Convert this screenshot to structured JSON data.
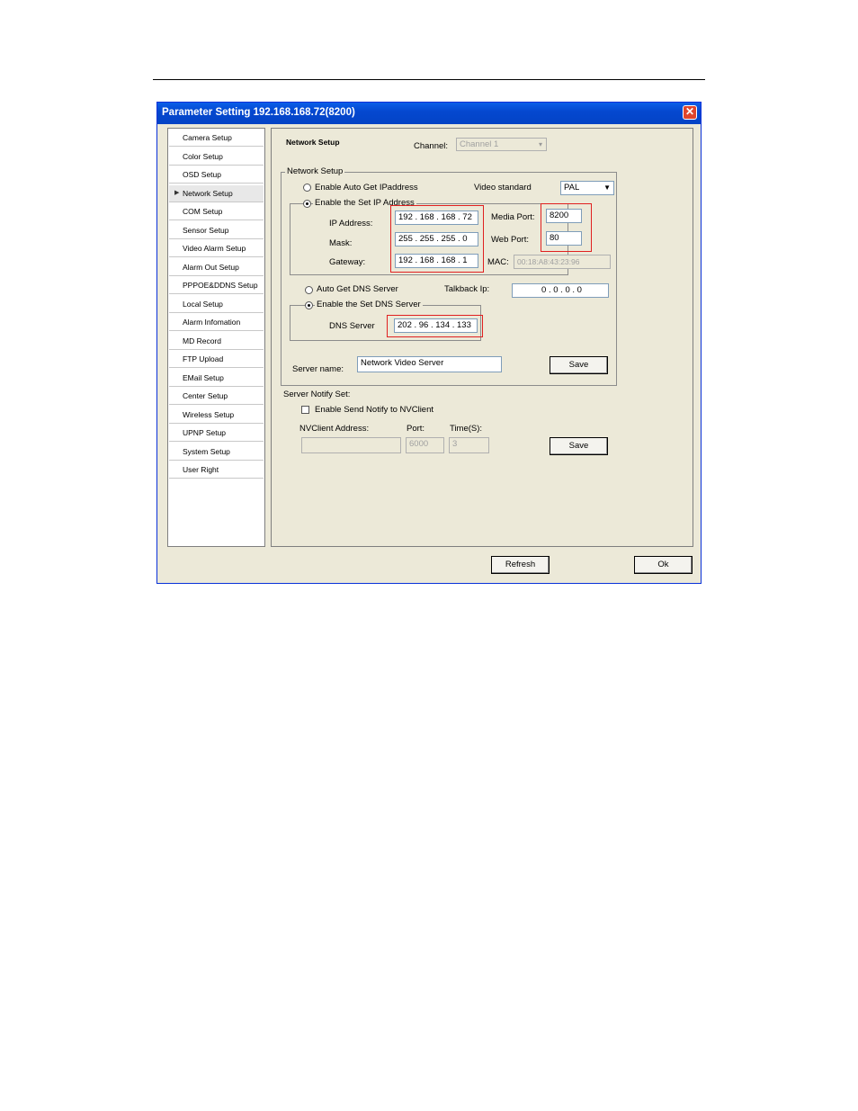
{
  "window": {
    "title": "Parameter Setting 192.168.168.72(8200)",
    "close": "✕"
  },
  "sidebar": {
    "items": [
      {
        "label": "Camera Setup"
      },
      {
        "label": "Color Setup"
      },
      {
        "label": "OSD Setup"
      },
      {
        "label": "Network Setup",
        "active": true
      },
      {
        "label": "COM Setup"
      },
      {
        "label": "Sensor Setup"
      },
      {
        "label": "Video Alarm Setup"
      },
      {
        "label": "Alarm Out Setup"
      },
      {
        "label": "PPPOE&DDNS Setup"
      },
      {
        "label": "Local Setup"
      },
      {
        "label": "Alarm Infomation"
      },
      {
        "label": "MD Record"
      },
      {
        "label": "FTP Upload"
      },
      {
        "label": "EMail Setup"
      },
      {
        "label": "Center Setup"
      },
      {
        "label": "Wireless Setup"
      },
      {
        "label": "UPNP Setup"
      },
      {
        "label": "System Setup"
      },
      {
        "label": "User Right"
      }
    ]
  },
  "panel": {
    "header": "Network Setup",
    "channel_label": "Channel:",
    "channel_value": "Channel 1",
    "network_group": "Network Setup",
    "auto_ip_label": "Enable Auto Get IPaddress",
    "set_ip_label": "Enable the Set IP Address",
    "ip_label": "IP Address:",
    "ip_value": "192 . 168 . 168 . 72",
    "mask_label": "Mask:",
    "mask_value": "255 . 255 . 255 .  0",
    "gateway_label": "Gateway:",
    "gateway_value": "192 . 168 . 168 .  1",
    "video_standard_label": "Video standard",
    "video_standard_value": "PAL",
    "media_port_label": "Media Port:",
    "media_port_value": "8200",
    "web_port_label": "Web Port:",
    "web_port_value": "80",
    "mac_label": "MAC:",
    "mac_value": "00:18:A8:43:23:96",
    "auto_dns_label": "Auto Get DNS Server",
    "set_dns_label": "Enable the Set DNS Server",
    "dns_label": "DNS Server",
    "dns_value": "202 .  96 . 134 . 133",
    "talkback_label": "Talkback Ip:",
    "talkback_value": "0   .   0   .   0   .   0",
    "server_name_label": "Server name:",
    "server_name_value": "Network Video Server",
    "save_label": "Save",
    "notify_group": "Server Notify Set:",
    "notify_check_label": "Enable Send Notify to NVClient",
    "nvclient_label": "NVClient Address:",
    "nvclient_value": "",
    "port_label": "Port:",
    "port_value": "6000",
    "time_label": "Time(S):",
    "time_value": "3",
    "save2_label": "Save"
  },
  "footer": {
    "refresh_label": "Refresh",
    "ok_label": "Ok"
  }
}
